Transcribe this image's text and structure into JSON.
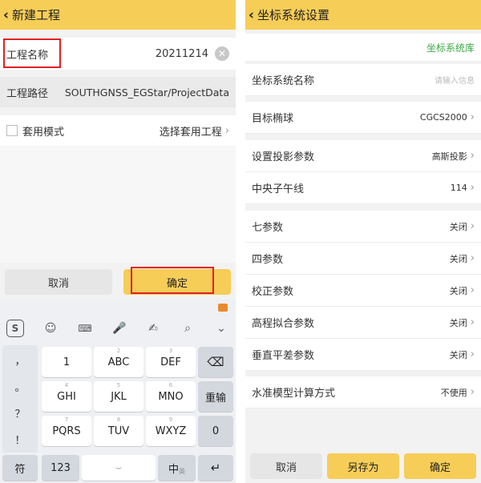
{
  "left": {
    "title": "新建工程",
    "project_name": {
      "label": "工程名称",
      "value": "20211214"
    },
    "project_path": {
      "label": "工程路径",
      "value": "SOUTHGNSS_EGStar/ProjectData"
    },
    "template": {
      "label": "套用模式",
      "action": "选择套用工程"
    },
    "cancel": "取消",
    "ok": "确定",
    "keyboard": {
      "side": [
        "，",
        "。",
        "？",
        "！"
      ],
      "keys": [
        {
          "main": "1",
          "sub": ""
        },
        {
          "main": "ABC",
          "sub": "2"
        },
        {
          "main": "DEF",
          "sub": "3"
        },
        {
          "main": "GHI",
          "sub": "4"
        },
        {
          "main": "JKL",
          "sub": "5"
        },
        {
          "main": "MNO",
          "sub": "6"
        },
        {
          "main": "PQRS",
          "sub": "7"
        },
        {
          "main": "TUV",
          "sub": "8"
        },
        {
          "main": "WXYZ",
          "sub": "9"
        }
      ],
      "reenter": "重输",
      "zero": "0",
      "fu": "符",
      "num": "123",
      "lang": "中",
      "lang_sub": "英",
      "tool_s": "S"
    }
  },
  "right": {
    "title": "坐标系统设置",
    "library": "坐标系统库",
    "rows": [
      {
        "label": "坐标系统名称",
        "value": "请输入信息",
        "placeholder": true
      },
      {
        "label": "目标椭球",
        "value": "CGCS2000"
      },
      {
        "label": "设置投影参数",
        "value": "高斯投影"
      },
      {
        "label": "中央子午线",
        "value": "114"
      },
      {
        "label": "七参数",
        "value": "关闭"
      },
      {
        "label": "四参数",
        "value": "关闭"
      },
      {
        "label": "校正参数",
        "value": "关闭"
      },
      {
        "label": "高程拟合参数",
        "value": "关闭"
      },
      {
        "label": "垂直平差参数",
        "value": "关闭"
      },
      {
        "label": "水准模型计算方式",
        "value": "不使用"
      }
    ],
    "cancel": "取消",
    "save_as": "另存为",
    "ok": "确定"
  },
  "colors": {
    "accent": "#f6cd57",
    "highlight": "#e02020",
    "library_link": "#3aa845"
  }
}
